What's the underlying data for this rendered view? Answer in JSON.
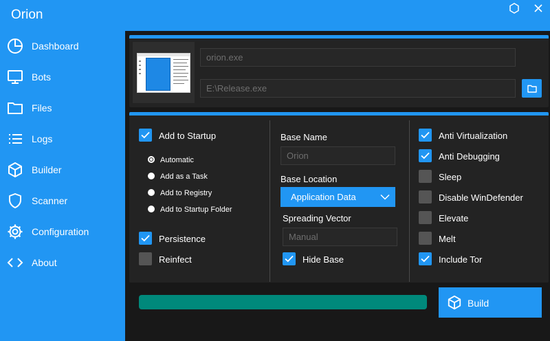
{
  "app": {
    "title": "Orion"
  },
  "sidebar": {
    "items": [
      {
        "label": "Dashboard",
        "icon": "pie-chart-icon"
      },
      {
        "label": "Bots",
        "icon": "monitor-icon"
      },
      {
        "label": "Files",
        "icon": "folder-icon"
      },
      {
        "label": "Logs",
        "icon": "list-icon"
      },
      {
        "label": "Builder",
        "icon": "cube-icon"
      },
      {
        "label": "Scanner",
        "icon": "shield-icon"
      },
      {
        "label": "Configuration",
        "icon": "gear-icon"
      },
      {
        "label": "About",
        "icon": "code-icon"
      }
    ]
  },
  "builder": {
    "output_name": "orion.exe",
    "output_path": "E:\\Release.exe",
    "startup": {
      "add_to_startup_label": "Add to Startup",
      "add_to_startup_checked": true,
      "modes": [
        "Automatic",
        "Add as a Task",
        "Add to Registry",
        "Add to Startup Folder"
      ],
      "selected_mode": "Automatic",
      "persistence_label": "Persistence",
      "persistence_checked": true,
      "reinfect_label": "Reinfect",
      "reinfect_checked": false
    },
    "base": {
      "name_label": "Base Name",
      "name_placeholder": "Orion",
      "location_label": "Base Location",
      "location_value": "Application Data",
      "spreading_label": "Spreading Vector",
      "spreading_placeholder": "Manual",
      "hide_base_label": "Hide Base",
      "hide_base_checked": true
    },
    "options": [
      {
        "label": "Anti Virtualization",
        "checked": true
      },
      {
        "label": "Anti Debugging",
        "checked": true
      },
      {
        "label": "Sleep",
        "checked": false
      },
      {
        "label": "Disable WinDefender",
        "checked": false
      },
      {
        "label": "Elevate",
        "checked": false
      },
      {
        "label": "Melt",
        "checked": false
      },
      {
        "label": "Include Tor",
        "checked": true
      }
    ],
    "progress": 1.0,
    "build_label": "Build"
  },
  "colors": {
    "accent": "#2196f3",
    "panel": "#232323",
    "background": "#181818",
    "progress": "#00897b"
  }
}
